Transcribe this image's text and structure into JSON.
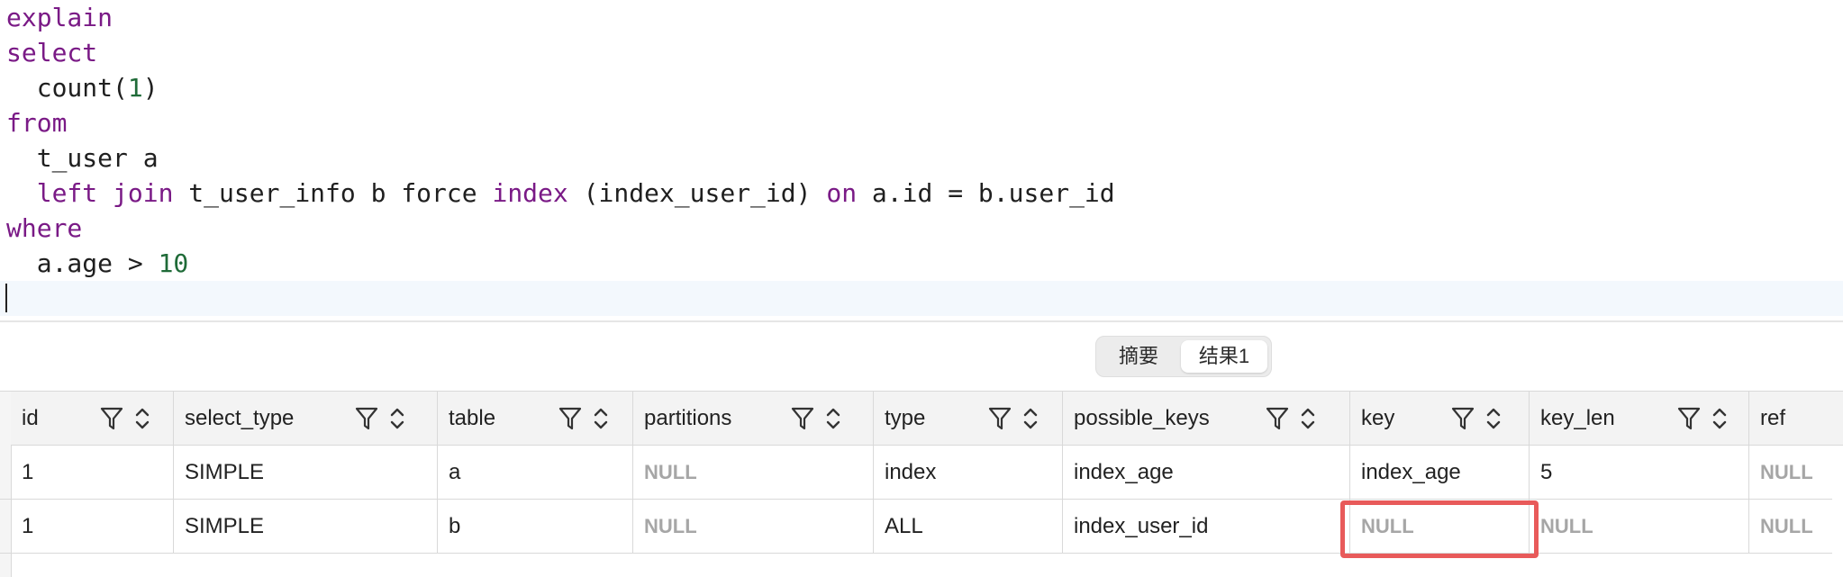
{
  "editor": {
    "lines": [
      {
        "indent": "",
        "tokens": [
          {
            "t": "explain",
            "c": "kw"
          }
        ]
      },
      {
        "indent": "",
        "tokens": [
          {
            "t": "select",
            "c": "kw"
          }
        ]
      },
      {
        "indent": "  ",
        "tokens": [
          {
            "t": "count(",
            "c": ""
          },
          {
            "t": "1",
            "c": "num"
          },
          {
            "t": ")",
            "c": ""
          }
        ]
      },
      {
        "indent": "",
        "tokens": [
          {
            "t": "from",
            "c": "kw"
          }
        ]
      },
      {
        "indent": "  ",
        "tokens": [
          {
            "t": "t_user a",
            "c": ""
          }
        ]
      },
      {
        "indent": "  ",
        "tokens": [
          {
            "t": "left",
            "c": "kw"
          },
          {
            "t": " ",
            "c": ""
          },
          {
            "t": "join",
            "c": "kw"
          },
          {
            "t": " t_user_info b force ",
            "c": ""
          },
          {
            "t": "index",
            "c": "kw"
          },
          {
            "t": " (index_user_id) ",
            "c": ""
          },
          {
            "t": "on",
            "c": "kw"
          },
          {
            "t": " a.id = b.user_id",
            "c": ""
          }
        ]
      },
      {
        "indent": "",
        "tokens": [
          {
            "t": "where",
            "c": "kw"
          }
        ]
      },
      {
        "indent": "  ",
        "tokens": [
          {
            "t": "a.age > ",
            "c": ""
          },
          {
            "t": "10",
            "c": "num"
          }
        ]
      }
    ]
  },
  "result_tabs": [
    "摘要",
    "结果1"
  ],
  "active_tab": 1,
  "grid": {
    "columns": [
      "id",
      "select_type",
      "table",
      "partitions",
      "type",
      "possible_keys",
      "key",
      "key_len",
      "ref"
    ],
    "rows": [
      [
        "1",
        "SIMPLE",
        "a",
        "NULL",
        "index",
        "index_age",
        "index_age",
        "5",
        "NULL"
      ],
      [
        "1",
        "SIMPLE",
        "b",
        "NULL",
        "ALL",
        "index_user_id",
        "NULL",
        "NULL",
        "NULL"
      ]
    ],
    "null_text": "NULL",
    "header_icons": [
      "filter-icon",
      "sort-icon"
    ]
  },
  "highlight_color": "#e85a5a"
}
